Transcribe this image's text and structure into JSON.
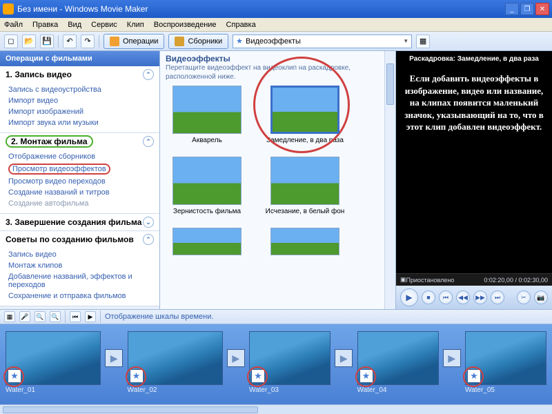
{
  "titlebar": {
    "title": "Без имени - Windows Movie Maker"
  },
  "menu": {
    "file": "Файл",
    "edit": "Правка",
    "view": "Вид",
    "service": "Сервис",
    "clip": "Клип",
    "play": "Воспроизведение",
    "help": "Справка"
  },
  "toolbar": {
    "tasks": "Операции",
    "collections": "Сборники",
    "combo": "Видеоэффекты"
  },
  "tasks": {
    "header": "Операции с фильмами",
    "s1": {
      "title": "1. Запись видео",
      "l1": "Запись с видеоустройства",
      "l2": "Импорт видео",
      "l3": "Импорт изображений",
      "l4": "Импорт звука или музыки"
    },
    "s2": {
      "title": "2. Монтаж фильма",
      "l1": "Отображение сборников",
      "l2": "Просмотр видеоэффектов",
      "l3": "Просмотр видео переходов",
      "l4": "Создание названий и титров",
      "l5": "Создание автофильма"
    },
    "s3": {
      "title": "3. Завершение создания фильма"
    },
    "s4": {
      "title": "Советы по созданию фильмов",
      "l1": "Запись видео",
      "l2": "Монтаж клипов",
      "l3": "Добавление названий, эффектов и переходов",
      "l4": "Сохранение и отправка фильмов"
    }
  },
  "collection": {
    "title": "Видеоэффекты",
    "subtitle": "Перетащите видеоэффект на видеоклип на раскадровке, расположенной ниже.",
    "fx1": "Акварель",
    "fx2": "Замедление, в два раза",
    "fx3": "Зернистость фильма",
    "fx4": "Исчезание, в белый фон"
  },
  "preview": {
    "header": "Раскадровка: Замедление, в два раза",
    "body": "Если добавить видеоэффекты в изображение, видео или название, на клипах появится маленький значок, указывающий на то, что в этот клип добавлен видеоэффект.",
    "status_left": "Приостановлено",
    "status_right": "0:02:20,00 / 0:02:30,00"
  },
  "tl_toolbar": {
    "label": "Отображение шкалы времени."
  },
  "storyboard": {
    "c1": "Water_01",
    "c2": "Water_02",
    "c3": "Water_03",
    "c4": "Water_04",
    "c5": "Water_05"
  }
}
